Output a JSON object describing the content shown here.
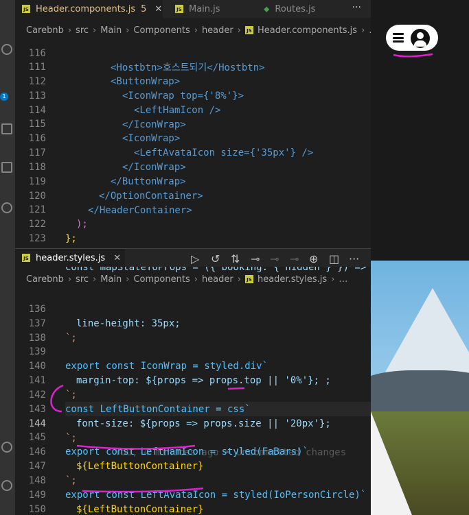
{
  "top_tabs": [
    {
      "label": "Header.components.js",
      "count": "5",
      "close": "✕",
      "active": true
    },
    {
      "label": "Main.js",
      "close": "",
      "active": false
    },
    {
      "label": "Routes.js",
      "close": "",
      "active": false
    }
  ],
  "top_breadcrumb": [
    "Carebnb",
    "src",
    "Main",
    "Components",
    "header",
    "Header.components.js",
    "…"
  ],
  "top_code": [
    {
      "n": "116",
      "t": "<Hostbtn>호스트되기</Hostbtn>"
    },
    {
      "n": "111",
      "t": "<ButtonWrap>"
    },
    {
      "n": "112",
      "t": "<IconWrap top={'8%'}>"
    },
    {
      "n": "113",
      "t": "<LeftHamIcon />"
    },
    {
      "n": "114",
      "t": "</IconWrap>"
    },
    {
      "n": "115",
      "t": "<IconWrap>"
    },
    {
      "n": "116",
      "t": "<LeftAvataIcon size={'35px'} />"
    },
    {
      "n": "117",
      "t": "</IconWrap>"
    },
    {
      "n": "118",
      "t": "</ButtonWrap>"
    },
    {
      "n": "119",
      "t": "</OptionContainer>"
    },
    {
      "n": "120",
      "t": "</HeaderContainer>"
    },
    {
      "n": "121",
      "t": ");"
    },
    {
      "n": "122",
      "t": "};"
    },
    {
      "n": "123",
      "t": ""
    },
    {
      "n": "124",
      "t": "const mapStateToProps = ({ booking: { hidden } }) =>"
    }
  ],
  "bottom_tab": {
    "label": "header.styles.js",
    "close": "✕"
  },
  "bottom_breadcrumb": [
    "Carebnb",
    "src",
    "Main",
    "Components",
    "header",
    "header.styles.js",
    "…"
  ],
  "bottom_code": [
    {
      "n": "136",
      "t": "line-height: 35px;"
    },
    {
      "n": "137",
      "t": "`;"
    },
    {
      "n": "138",
      "t": ""
    },
    {
      "n": "139",
      "t": "export const IconWrap = styled.div`"
    },
    {
      "n": "140",
      "t": "margin-top: ${props => props.top || '0%'}; ;"
    },
    {
      "n": "141",
      "t": "`;"
    },
    {
      "n": "142",
      "t": "const LeftButtonContainer = css`"
    },
    {
      "n": "143",
      "t": "font-size: ${props => props.size || '20px'};"
    },
    {
      "n": "144",
      "t": "`;"
    },
    {
      "n": "145",
      "t": "export const LeftHamIcon = styled(FaBars)`"
    },
    {
      "n": "146",
      "t": "${LeftButtonContainer}"
    },
    {
      "n": "147",
      "t": "`;"
    },
    {
      "n": "148",
      "t": "export const LeftAvataIcon = styled(IoPersonCircle)`"
    },
    {
      "n": "149",
      "t": "${LeftButtonContainer}"
    },
    {
      "n": "150",
      "t": "`;"
    }
  ],
  "ghost_text": "You, 4 minutes ago • Uncommitted changes",
  "icons": {
    "js": "JS",
    "more": "···",
    "badge": "1"
  },
  "colors": {
    "annotation": "#e020d0"
  }
}
